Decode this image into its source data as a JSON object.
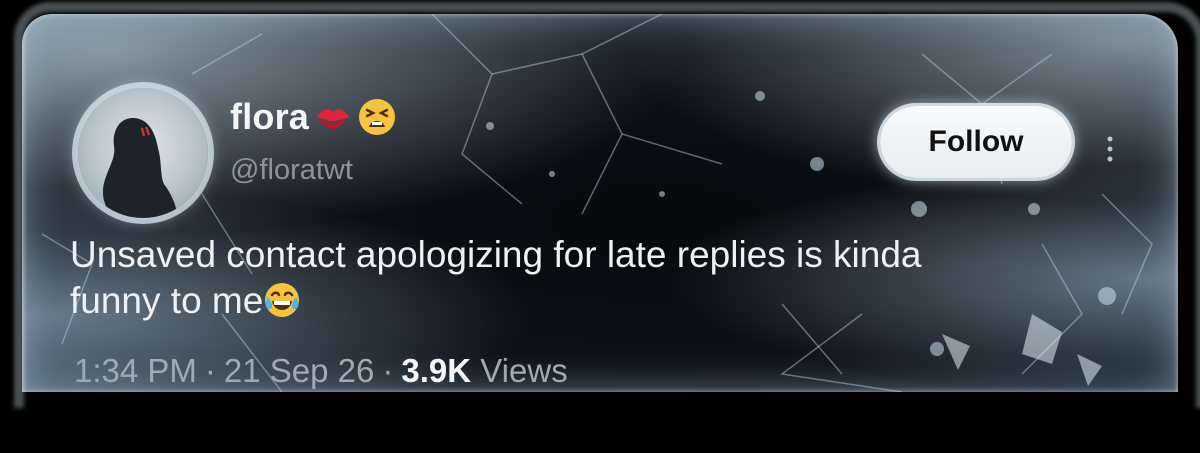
{
  "tweet": {
    "display_name": "flora",
    "name_emojis": [
      "kiss-mark-emoji",
      "tired-face-emoji"
    ],
    "handle": "@floratwt",
    "follow_label": "Follow",
    "text_line_1": "Unsaved contact apologizing for late replies is kinda",
    "text_line_2": "funny to me",
    "text_emoji": "face-with-tears-of-joy-emoji",
    "time": "1:34 PM",
    "date": "21 Sep 26",
    "separator": "·",
    "views_count": "3.9K",
    "views_label": "Views"
  },
  "colors": {
    "background": "#000000",
    "ice_dark": "#0b1016",
    "ice_edge": "#3d5566",
    "name": "#f2f4f6",
    "handle": "#8a949d",
    "follow_bg": "#fafbfc",
    "follow_text": "#111111",
    "meta": "#a0aab2"
  }
}
